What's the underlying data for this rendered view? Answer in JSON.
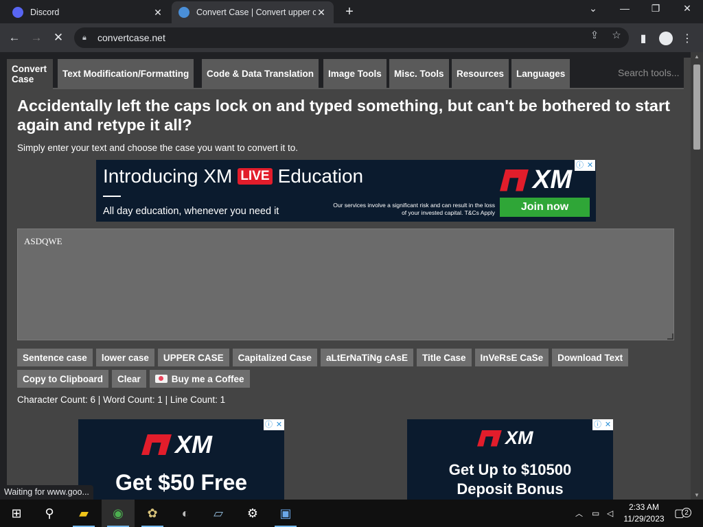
{
  "browser": {
    "tabs": [
      {
        "title": "Discord",
        "favicon_color": "#5865f2"
      },
      {
        "title": "Convert Case | Convert upper ca",
        "favicon_color": "#4a8fd8"
      }
    ],
    "new_tab": "+",
    "url": "convertcase.net",
    "window_controls": {
      "minimize": "—",
      "restore": "❐",
      "close": "✕",
      "tab_menu": "⌄"
    },
    "status": "Waiting for www.goo..."
  },
  "site": {
    "nav": [
      {
        "label": "Convert Case"
      },
      {
        "label": "Text Modification/Formatting"
      },
      {
        "label": "Code & Data Translation"
      },
      {
        "label": "Image Tools"
      },
      {
        "label": "Misc. Tools"
      },
      {
        "label": "Resources"
      },
      {
        "label": "Languages"
      }
    ],
    "search_placeholder": "Search tools...",
    "heading": "Accidentally left the caps lock on and typed something, but can't be bothered to start again and retype it all?",
    "subtitle": "Simply enter your text and choose the case you want to convert it to.",
    "input_text": "ASDQWE",
    "buttons_row1": [
      "Sentence case",
      "lower case",
      "UPPER CASE",
      "Capitalized Case",
      "aLtErNaTiNg cAsE",
      "Title Case",
      "InVeRsE CaSe",
      "Download Text"
    ],
    "buttons_row2": [
      "Copy to Clipboard",
      "Clear",
      "Buy me a Coffee"
    ],
    "counts": "Character Count: 6 | Word Count: 1 | Line Count: 1"
  },
  "ads": {
    "banner": {
      "headline_pre": "Introducing XM",
      "live": "LIVE",
      "headline_post": "Education",
      "sub": "All day education, whenever you need it",
      "risk": "Our services involve a significant risk and can result in the  loss of your invested capital. T&Cs Apply",
      "logo": "XM",
      "cta": "Join now"
    },
    "left_box": {
      "logo": "XM",
      "text": "Get $50 Free"
    },
    "right_box": {
      "logo": "XM",
      "text_line1": "Get Up to $10500",
      "text_line2": "Deposit Bonus"
    },
    "adchoice_info": "ⓘ",
    "adchoice_close": "✕"
  },
  "taskbar": {
    "time": "2:33 AM",
    "date": "11/29/2023",
    "notification_count": "2"
  }
}
